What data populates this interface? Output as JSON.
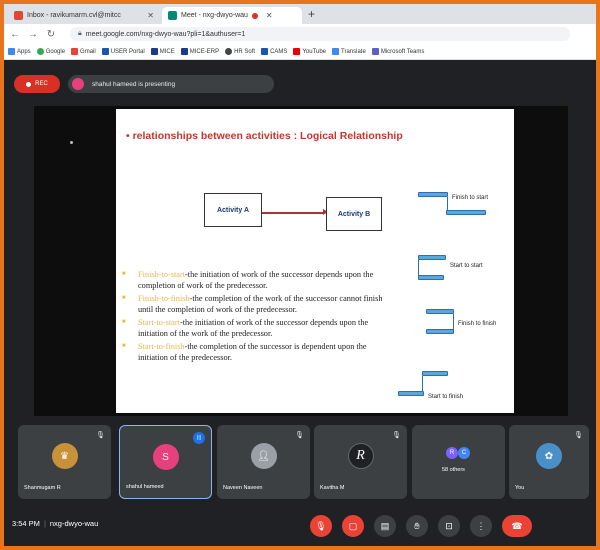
{
  "browser": {
    "tabs": [
      {
        "label": "Inbox - ravikumarm.cvl@mitcc",
        "active": false
      },
      {
        "label": "Meet - nxg-dwyo-wau",
        "active": true
      }
    ],
    "new_tab": "+",
    "url": "meet.google.com/nxg-dwyo-wau?pli=1&authuser=1",
    "bookmarks": [
      "Apps",
      "Google",
      "Gmail",
      "USER Portal",
      "MICE",
      "MICE-ERP",
      "HR Soft",
      "CAMS",
      "YouTube",
      "Translate",
      "Microsoft Teams"
    ]
  },
  "meet": {
    "rec_label": "REC",
    "presenter_text": "shahul hameed is presenting",
    "meeting_code": "nxg-dwyo-wau",
    "time": "3:54 PM",
    "separator": "|"
  },
  "slide": {
    "title": "relationships between activities : Logical Relationship",
    "activity_a": "Activity A",
    "activity_b": "Activity B",
    "bullets": [
      {
        "term": "Finish-to-start",
        "text": "-the initiation of work of the successor depends upon the completion of work of the predecessor."
      },
      {
        "term": "Finish-to-finish",
        "text": "-the completion of the work of the successor cannot finish until the completion of work of the predecessor."
      },
      {
        "term": "Start-to-start",
        "text": "-the initiation of work of the successor depends upon the initiation of the work of the predecessor."
      },
      {
        "term": "Start-to-finish",
        "text": "-the completion of the successor is dependent upon the initiation of the predecessor."
      }
    ],
    "diagram_labels": [
      "Finish to start",
      "Start to start",
      "Finish to finish",
      "Start to finish"
    ]
  },
  "participants": [
    {
      "name": "Shanmugam R",
      "initial": "",
      "color": "#c8923a",
      "speaking": false
    },
    {
      "name": "shahul hameed",
      "initial": "S",
      "color": "#e8407c",
      "speaking": true
    },
    {
      "name": "Naveen Naveen",
      "initial": "",
      "color": "#9aa0a6",
      "speaking": false
    },
    {
      "name": "Kavitha M",
      "initial": "R",
      "color": "#202124",
      "speaking": false
    },
    {
      "name": "58 others",
      "initial": "",
      "color": "",
      "speaking": false
    },
    {
      "name": "You",
      "initial": "",
      "color": "#4a90c8",
      "speaking": false
    }
  ],
  "others_avatars": [
    "R",
    "C"
  ],
  "colors": {
    "accent": "#e8741c",
    "danger": "#ea4335",
    "meet_bg": "#202124",
    "tile_bg": "#3c4043"
  }
}
